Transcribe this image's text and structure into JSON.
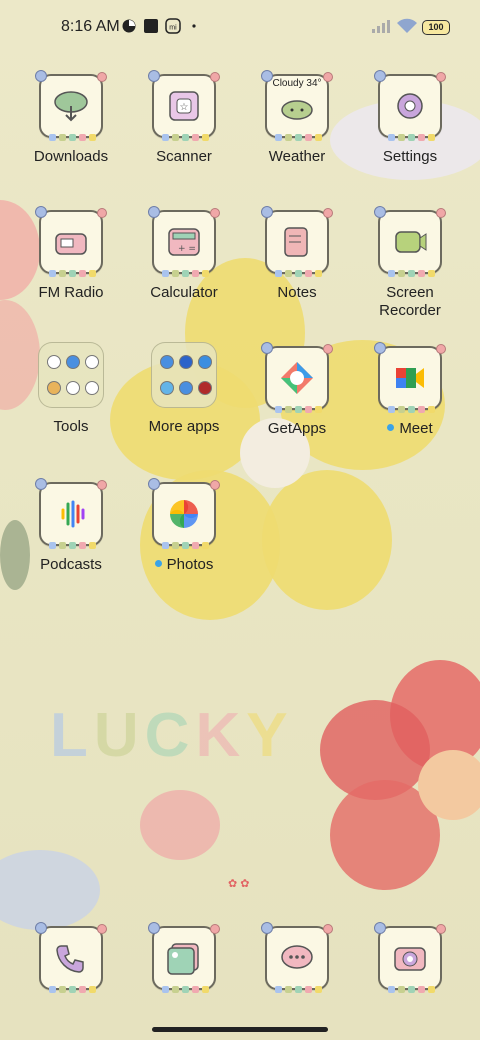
{
  "status_bar": {
    "time": "8:16 AM",
    "battery": "100"
  },
  "weather_text": "Cloudy 34°",
  "apps": {
    "row1": [
      {
        "label": "Downloads",
        "icon": "cloud-download-icon"
      },
      {
        "label": "Scanner",
        "icon": "scanner-icon"
      },
      {
        "label": "Weather",
        "icon": "weather-cloud-icon"
      },
      {
        "label": "Settings",
        "icon": "gear-icon"
      }
    ],
    "row2": [
      {
        "label": "FM Radio",
        "icon": "radio-icon"
      },
      {
        "label": "Calculator",
        "icon": "calculator-icon"
      },
      {
        "label": "Notes",
        "icon": "notes-icon"
      },
      {
        "label": "Screen Recorder",
        "icon": "screen-recorder-icon"
      }
    ],
    "row3": [
      {
        "label": "Tools",
        "icon": "folder-icon"
      },
      {
        "label": "More apps",
        "icon": "folder-icon"
      },
      {
        "label": "GetApps",
        "icon": "getapps-icon"
      },
      {
        "label": "Meet",
        "icon": "meet-icon"
      }
    ],
    "row4": [
      {
        "label": "Podcasts",
        "icon": "podcasts-icon"
      },
      {
        "label": "Photos",
        "icon": "photos-icon"
      }
    ]
  },
  "dock": [
    {
      "icon": "phone-icon"
    },
    {
      "icon": "gallery-icon"
    },
    {
      "icon": "messages-icon"
    },
    {
      "icon": "camera-icon"
    }
  ],
  "wallpaper_word": "LUCKY",
  "colors": {
    "accent_dot": "#3aa3e8",
    "yellow_flower": "#eedb70",
    "red_flower": "#e25a5a"
  }
}
